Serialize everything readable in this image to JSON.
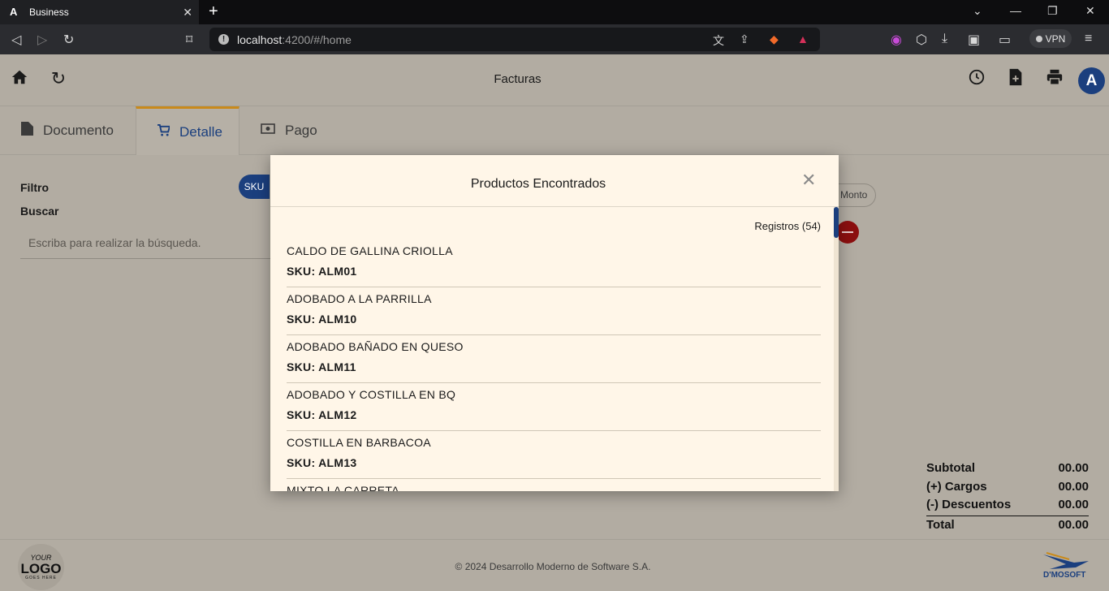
{
  "browser": {
    "tab_title": "Business",
    "url_host": "localhost",
    "url_rest": ":4200/#/home",
    "vpn_label": "VPN"
  },
  "app": {
    "title": "Facturas",
    "avatar_letter": "A"
  },
  "tabs": [
    {
      "label": "Documento",
      "icon": "document-icon"
    },
    {
      "label": "Detalle",
      "icon": "cart-icon",
      "active": true
    },
    {
      "label": "Pago",
      "icon": "money-icon"
    }
  ],
  "filter": {
    "filtro_label": "Filtro",
    "buscar_label": "Buscar",
    "sku_chip": "SKU",
    "monto_chip": "Monto",
    "search_placeholder": "Escriba para realizar la búsqueda."
  },
  "modal": {
    "title": "Productos Encontrados",
    "registros": "Registros (54)",
    "results": [
      {
        "name": "CALDO DE GALLINA CRIOLLA",
        "sku": "SKU: ALM01"
      },
      {
        "name": "ADOBADO A LA PARRILLA",
        "sku": "SKU: ALM10"
      },
      {
        "name": "ADOBADO BAÑADO EN QUESO",
        "sku": "SKU: ALM11"
      },
      {
        "name": "ADOBADO Y COSTILLA EN BQ",
        "sku": "SKU: ALM12"
      },
      {
        "name": "COSTILLA EN BARBACOA",
        "sku": "SKU: ALM13"
      },
      {
        "name": "MIXTO LA CARRETA",
        "sku": ""
      }
    ]
  },
  "totals": {
    "subtotal_label": "Subtotal",
    "subtotal": "00.00",
    "cargos_label": "(+) Cargos",
    "cargos": "00.00",
    "descuentos_label": "(-) Descuentos",
    "descuentos": "00.00",
    "total_label": "Total",
    "total": "00.00"
  },
  "footer": {
    "copyright": "© 2024 Desarrollo Moderno de Software S.A.",
    "logo_line1": "YOUR",
    "logo_line2": "LOGO",
    "logo_line3": "GOES HERE",
    "brand": "D'MOSOFT"
  },
  "colors": {
    "primary": "#1b3f7e",
    "accent": "#c98a1b",
    "danger": "#8c0f0f",
    "modal_bg": "#fff6e8"
  }
}
